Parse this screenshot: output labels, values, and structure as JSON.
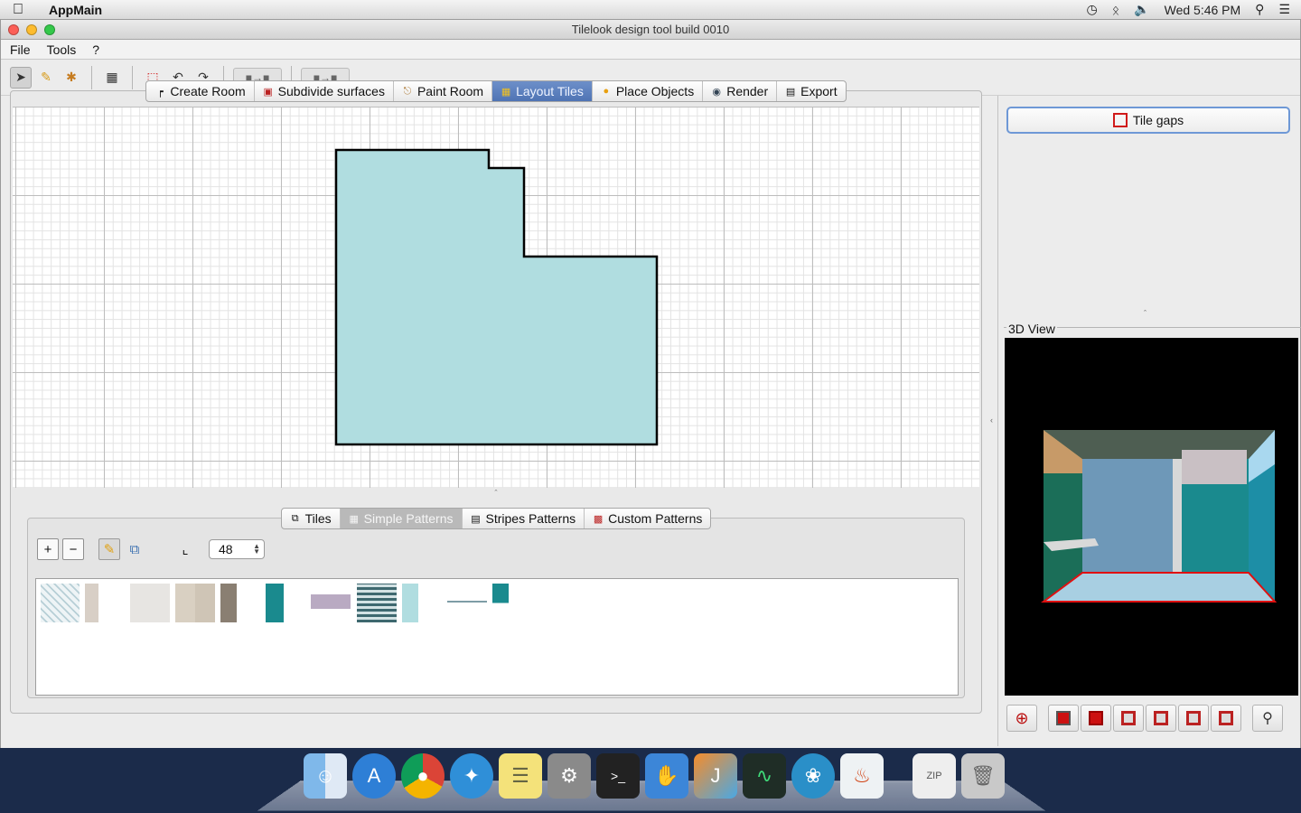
{
  "menubar": {
    "app_name": "AppMain",
    "clock": "Wed 5:46 PM"
  },
  "window": {
    "title": "Tilelook design tool build 0010"
  },
  "menu": {
    "items": [
      "File",
      "Tools",
      "?"
    ]
  },
  "tabs": [
    {
      "label": "Create Room",
      "icon": "create-room-icon"
    },
    {
      "label": "Subdivide surfaces",
      "icon": "subdivide-icon"
    },
    {
      "label": "Paint Room",
      "icon": "paint-icon"
    },
    {
      "label": "Layout Tiles",
      "icon": "checker-icon",
      "active": true
    },
    {
      "label": "Place Objects",
      "icon": "duck-icon"
    },
    {
      "label": "Render",
      "icon": "camera-icon"
    },
    {
      "label": "Export",
      "icon": "export-icon"
    }
  ],
  "pattern_tabs": [
    {
      "label": "Tiles",
      "icon": "tiles-icon"
    },
    {
      "label": "Simple Patterns",
      "icon": "grid-icon",
      "active": true
    },
    {
      "label": "Stripes Patterns",
      "icon": "stripes-icon"
    },
    {
      "label": "Custom Patterns",
      "icon": "custom-icon"
    }
  ],
  "pattern_toolbar": {
    "size_value": "48"
  },
  "right_panel": {
    "tile_gaps_label": "Tile gaps",
    "view3d_label": "3D View"
  },
  "colors": {
    "room_fill": "#b0dde0",
    "active_tab": "#5a7fbf",
    "wall_teal": "#1a8a8e",
    "floor_blue": "#a8cfe2"
  }
}
